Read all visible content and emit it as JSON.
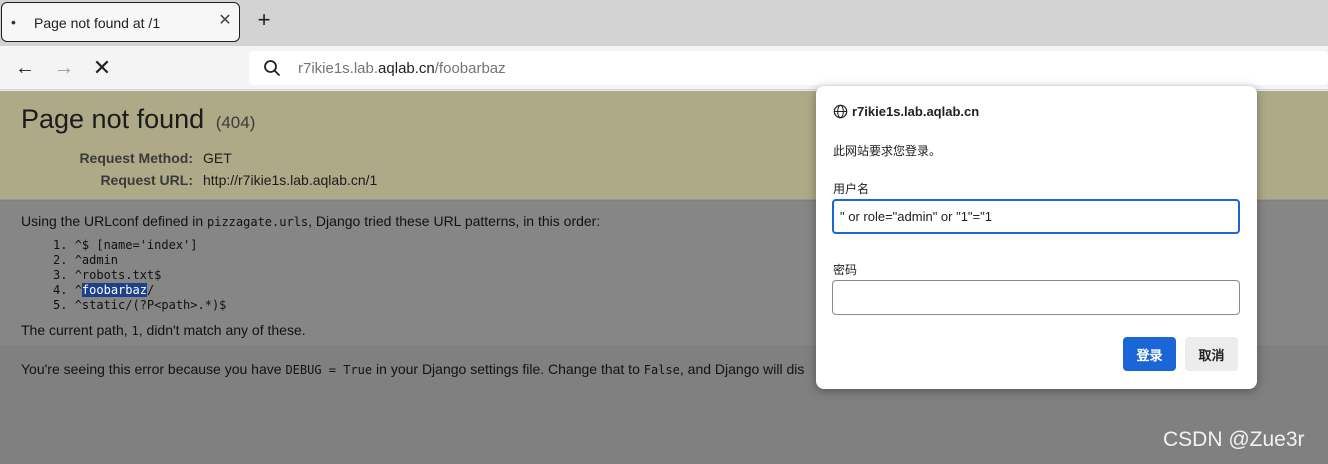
{
  "browser": {
    "tab": {
      "bullet": "•",
      "title": "Page not found at /1",
      "close_glyph": "✕"
    },
    "new_tab_glyph": "+",
    "nav": {
      "back": "←",
      "forward": "→",
      "stop": "✕"
    },
    "url": {
      "prefix": "r7ikie1s.lab.",
      "domain": "aqlab.cn",
      "path": "/foobarbaz"
    },
    "icons": {
      "search": "search-icon"
    }
  },
  "page": {
    "title": "Page not found",
    "status_code": "(404)",
    "request_method_label": "Request Method:",
    "request_method": "GET",
    "request_url_label": "Request URL:",
    "request_url": "http://r7ikie1s.lab.aqlab.cn/1",
    "urlconf_before": "Using the URLconf defined in ",
    "urlconf_module": "pizzagate.urls",
    "urlconf_after": ", Django tried these URL patterns, in this order:",
    "patterns": [
      {
        "num": "1.",
        "pre": "^$ [name='index']",
        "hl": "",
        "post": ""
      },
      {
        "num": "2.",
        "pre": "^admin",
        "hl": "",
        "post": ""
      },
      {
        "num": "3.",
        "pre": "^robots.txt$",
        "hl": "",
        "post": ""
      },
      {
        "num": "4.",
        "pre": "^",
        "hl": "foobarbaz",
        "post": "/"
      },
      {
        "num": "5.",
        "pre": "^static/(?P<path>.*)$",
        "hl": "",
        "post": ""
      }
    ],
    "current_path_before": "The current path, ",
    "current_path_value": "1",
    "current_path_after": ", didn't match any of these.",
    "explain_before": "You're seeing this error because you have ",
    "explain_code1": "DEBUG = True",
    "explain_middle": " in your Django settings file. Change that to ",
    "explain_code2": "False",
    "explain_after": ", and Django will dis"
  },
  "dialog": {
    "host": "r7ikie1s.lab.aqlab.cn",
    "message": "此网站要求您登录。",
    "username_label": "用户名",
    "username_value": "\" or role=\"admin\" or \"1\"=\"1",
    "password_label": "密码",
    "password_value": "",
    "login_button": "登录",
    "cancel_button": "取消",
    "accent_color": "#1a66d6"
  },
  "watermark": "CSDN @Zue3r"
}
